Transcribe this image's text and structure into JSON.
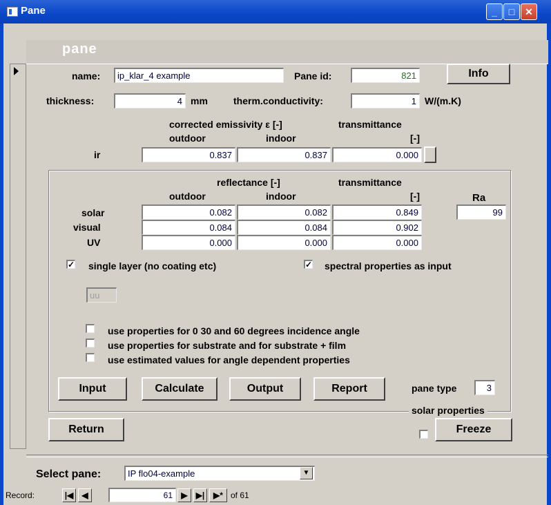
{
  "window": {
    "title": "Pane"
  },
  "form": {
    "heading": "pane",
    "name_label": "name:",
    "name_value": "ip_klar_4 example",
    "pane_id_label": "Pane id:",
    "pane_id_value": "821",
    "info_label": "Info",
    "thickness_label": "thickness:",
    "thickness_value": "4",
    "thickness_unit": "mm",
    "conductivity_label": "therm.conductivity:",
    "conductivity_value": "1",
    "conductivity_unit": "W/(m.K)",
    "emissivity_header": "corrected emissivity  ε [-]",
    "transmittance_header1": "transmittance",
    "transmittance_header1_unit": "[-]",
    "outdoor_label": "outdoor",
    "indoor_label": "indoor",
    "ir_label": "ir",
    "ir_outdoor": "0.837",
    "ir_indoor": "0.837",
    "ir_transmittance": "0.000",
    "reflectance_header": "reflectance [-]",
    "transmittance_header2": "transmittance",
    "transmittance_header2_unit": "[-]",
    "outdoor2_label": "outdoor",
    "indoor2_label": "indoor",
    "ra_label": "Ra",
    "rows": [
      {
        "label": "solar",
        "outdoor": "0.082",
        "indoor": "0.082",
        "transmittance": "0.849"
      },
      {
        "label": "visual",
        "outdoor": "0.084",
        "indoor": "0.084",
        "transmittance": "0.902"
      },
      {
        "label": "UV",
        "outdoor": "0.000",
        "indoor": "0.000",
        "transmittance": "0.000"
      }
    ],
    "ra_value": "99",
    "single_layer_label": "single layer (no coating etc)",
    "single_layer_checked": true,
    "spectral_label": "spectral properties as input",
    "spectral_checked": true,
    "uu_label": "uu",
    "opt1_label": "use properties for 0 30 and 60 degrees incidence angle",
    "opt2_label": "use properties for substrate and for substrate + film",
    "opt3_label": "use estimated values for angle dependent properties",
    "input_btn": "Input",
    "calculate_btn": "Calculate",
    "output_btn": "Output",
    "report_btn": "Report",
    "pane_type_label": "pane type",
    "pane_type_value": "3",
    "solar_props_label": "solar properties",
    "return_btn": "Return",
    "freeze_btn": "Freeze",
    "select_pane_label": "Select pane:",
    "select_pane_value": "IP flo04-example"
  },
  "nav": {
    "record_label": "Record:",
    "current": "61",
    "of_label": "of 61"
  }
}
